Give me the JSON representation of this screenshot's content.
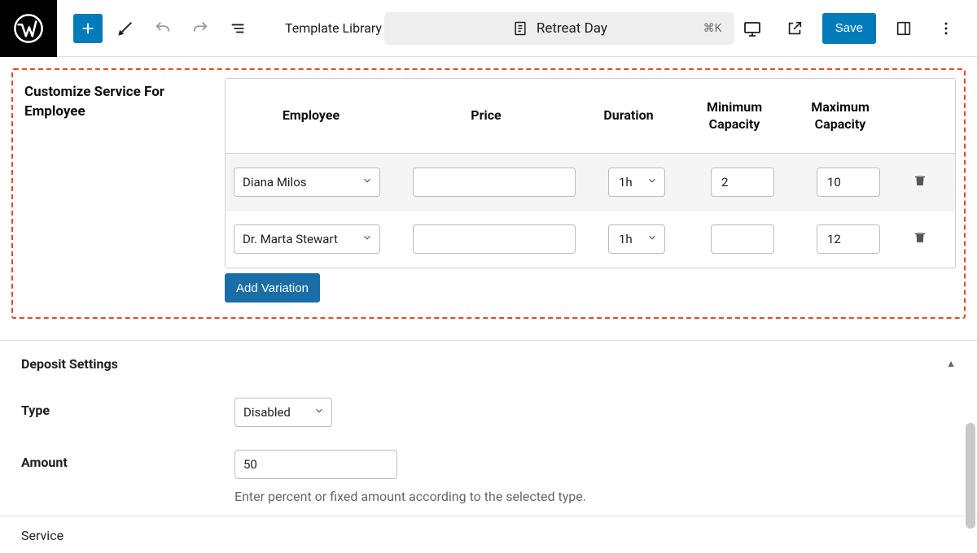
{
  "topbar": {
    "template_library_label": "Template Library",
    "doc_title": "Retreat Day",
    "shortcut": "⌘K",
    "save_label": "Save"
  },
  "customize_section": {
    "title": "Customize Service For Employee",
    "headers": {
      "employee": "Employee",
      "price": "Price",
      "duration": "Duration",
      "min_cap": "Minimum Capacity",
      "max_cap": "Maximum Capacity"
    },
    "rows": [
      {
        "employee": "Diana Milos",
        "price": "",
        "duration": "1h",
        "min": "2",
        "max": "10"
      },
      {
        "employee": "Dr. Marta Stewart",
        "price": "",
        "duration": "1h",
        "min": "",
        "max": "12"
      }
    ],
    "add_variation_label": "Add Variation"
  },
  "deposit": {
    "panel_title": "Deposit Settings",
    "type_label": "Type",
    "type_value": "Disabled",
    "amount_label": "Amount",
    "amount_value": "50",
    "amount_hint": "Enter percent or fixed amount according to the selected type."
  },
  "bottom": {
    "service_label": "Service"
  }
}
